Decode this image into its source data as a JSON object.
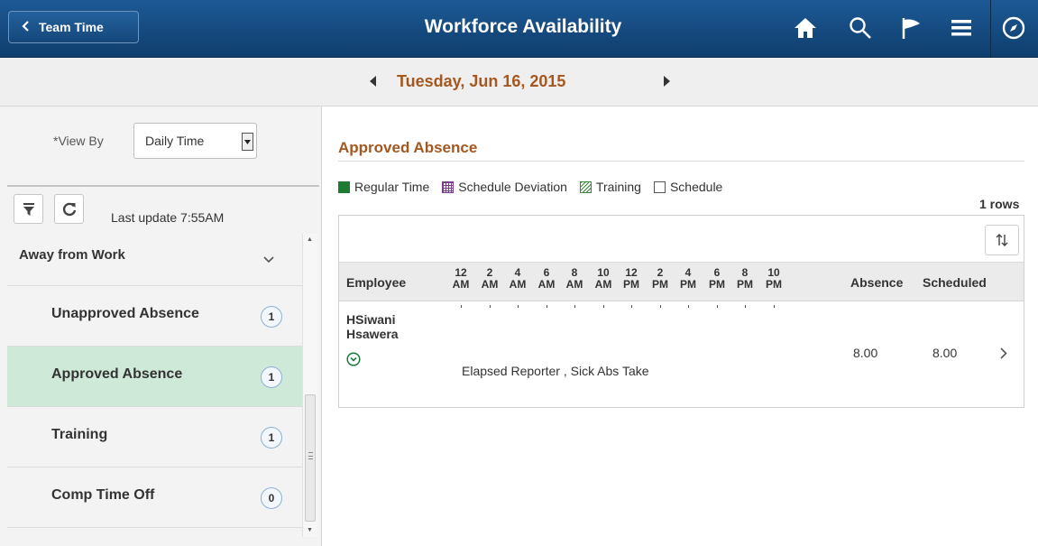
{
  "header": {
    "back_label": "Team Time",
    "title": "Workforce Availability",
    "icons": [
      "home-icon",
      "search-icon",
      "flag-icon",
      "menu-icon",
      "compass-icon"
    ]
  },
  "datebar": {
    "date": "Tuesday, Jun 16, 2015"
  },
  "left": {
    "view_by_label": "*View By",
    "view_by_value": "Daily Time",
    "last_update": "Last update 7:55AM",
    "group": {
      "title": "Away from Work",
      "items": [
        {
          "label": "Unapproved Absence",
          "count": "1"
        },
        {
          "label": "Approved Absence",
          "count": "1"
        },
        {
          "label": "Training",
          "count": "1"
        },
        {
          "label": "Comp Time Off",
          "count": "0"
        }
      ]
    }
  },
  "main": {
    "section_title": "Approved Absence",
    "legend": [
      {
        "label": "Regular Time",
        "color": "#1e7b34"
      },
      {
        "label": "Schedule Deviation",
        "color": "#7b3b8f"
      },
      {
        "label": "Training",
        "color": "#3a8a3a"
      },
      {
        "label": "Schedule",
        "color": "#ffffff"
      }
    ],
    "rows_count": "1 rows",
    "columns": {
      "employee": "Employee",
      "absence": "Absence",
      "scheduled": "Scheduled"
    },
    "hours": [
      {
        "num": "12",
        "ampm": "AM"
      },
      {
        "num": "2",
        "ampm": "AM"
      },
      {
        "num": "4",
        "ampm": "AM"
      },
      {
        "num": "6",
        "ampm": "AM"
      },
      {
        "num": "8",
        "ampm": "AM"
      },
      {
        "num": "10",
        "ampm": "AM"
      },
      {
        "num": "12",
        "ampm": "PM"
      },
      {
        "num": "2",
        "ampm": "PM"
      },
      {
        "num": "4",
        "ampm": "PM"
      },
      {
        "num": "6",
        "ampm": "PM"
      },
      {
        "num": "8",
        "ampm": "PM"
      },
      {
        "num": "10",
        "ampm": "PM"
      }
    ],
    "rows": [
      {
        "employee": "HSiwani Hsawera",
        "description": "Elapsed Reporter , Sick Abs Take",
        "absence": "8.00",
        "scheduled": "8.00"
      }
    ]
  },
  "colors": {
    "header_bg": "#174f86",
    "accent_orange": "#a4571f",
    "selected_item": "#cfe9d8"
  }
}
